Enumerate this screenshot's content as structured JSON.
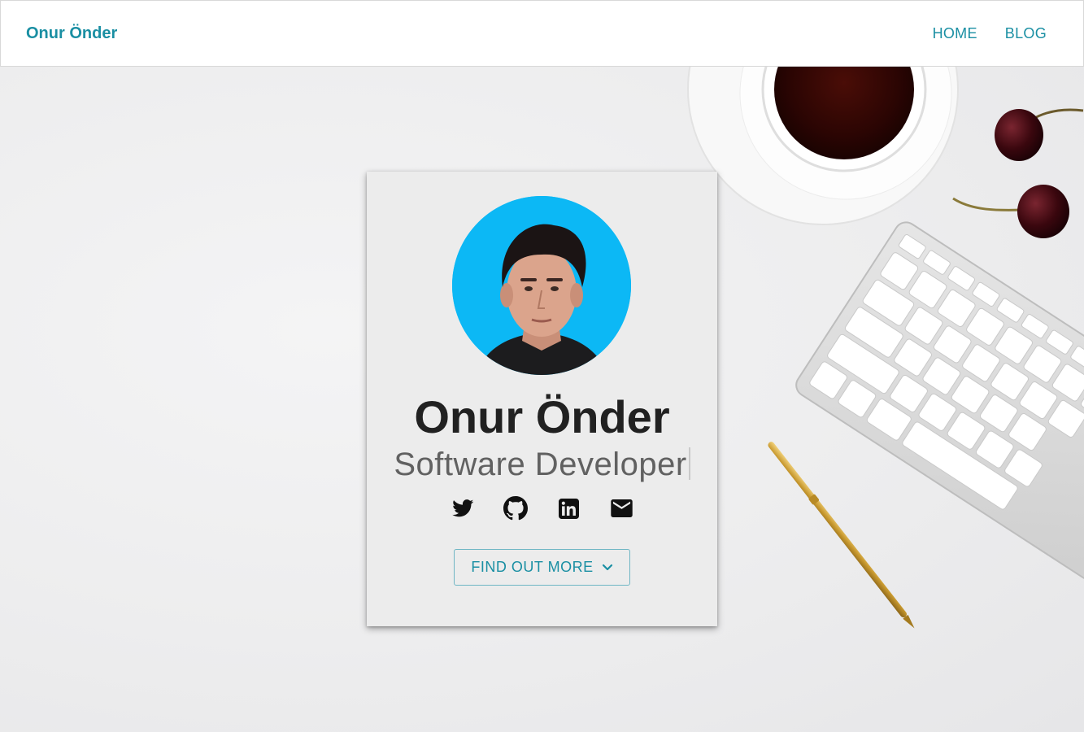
{
  "navbar": {
    "brand": "Onur Önder",
    "links": [
      {
        "label": "HOME"
      },
      {
        "label": "BLOG"
      }
    ]
  },
  "profile": {
    "name": "Onur Önder",
    "role": "Software Developer",
    "avatar_bg": "#0cb8f5"
  },
  "socials": [
    {
      "icon": "twitter-icon"
    },
    {
      "icon": "github-icon"
    },
    {
      "icon": "linkedin-icon"
    },
    {
      "icon": "mail-icon"
    }
  ],
  "cta": {
    "label": "FIND OUT MORE",
    "icon": "chevron-down-icon"
  },
  "colors": {
    "accent": "#1a8fa3",
    "card_bg": "#ececec",
    "text_dark": "#212121",
    "text_muted": "#616161"
  }
}
